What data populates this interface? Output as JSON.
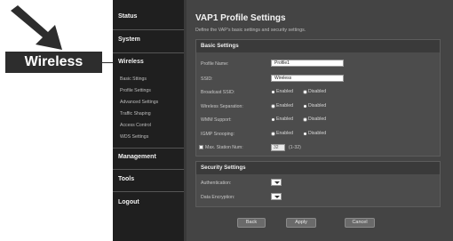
{
  "callout": {
    "label": "Wireless"
  },
  "sidebar": {
    "items": [
      "Status",
      "System",
      "Wireless",
      "Management",
      "Tools",
      "Logout"
    ],
    "wireless_sub": [
      "Basic Sttings",
      "Profile Settings",
      "Advanced Settings",
      "Traffic Shaping",
      "Access Control",
      "WDS Settings"
    ]
  },
  "page": {
    "title": "VAP1 Profile Settings",
    "description": "Define the VAP's basic settings and security settings."
  },
  "basic": {
    "heading": "Basic Settings",
    "profile_name_label": "Profile Name:",
    "profile_name_value": "Profile1",
    "ssid_label": "SSID:",
    "ssid_value": "Wireless",
    "broadcast_label": "Broadcast SSID:",
    "separation_label": "Wireless Separation:",
    "wmm_label": "WMM Support:",
    "igmp_label": "IGMP Snooping:",
    "enabled": "Enabled",
    "disabled": "Disabled",
    "max_station_label": "Max. Station Num:",
    "max_station_value": "32",
    "max_station_range": "(1-32)"
  },
  "security": {
    "heading": "Security Settings",
    "auth_label": "Authentication:",
    "enc_label": "Data Encryption:"
  },
  "buttons": {
    "back": "Back",
    "apply": "Apply",
    "cancel": "Cancel"
  }
}
